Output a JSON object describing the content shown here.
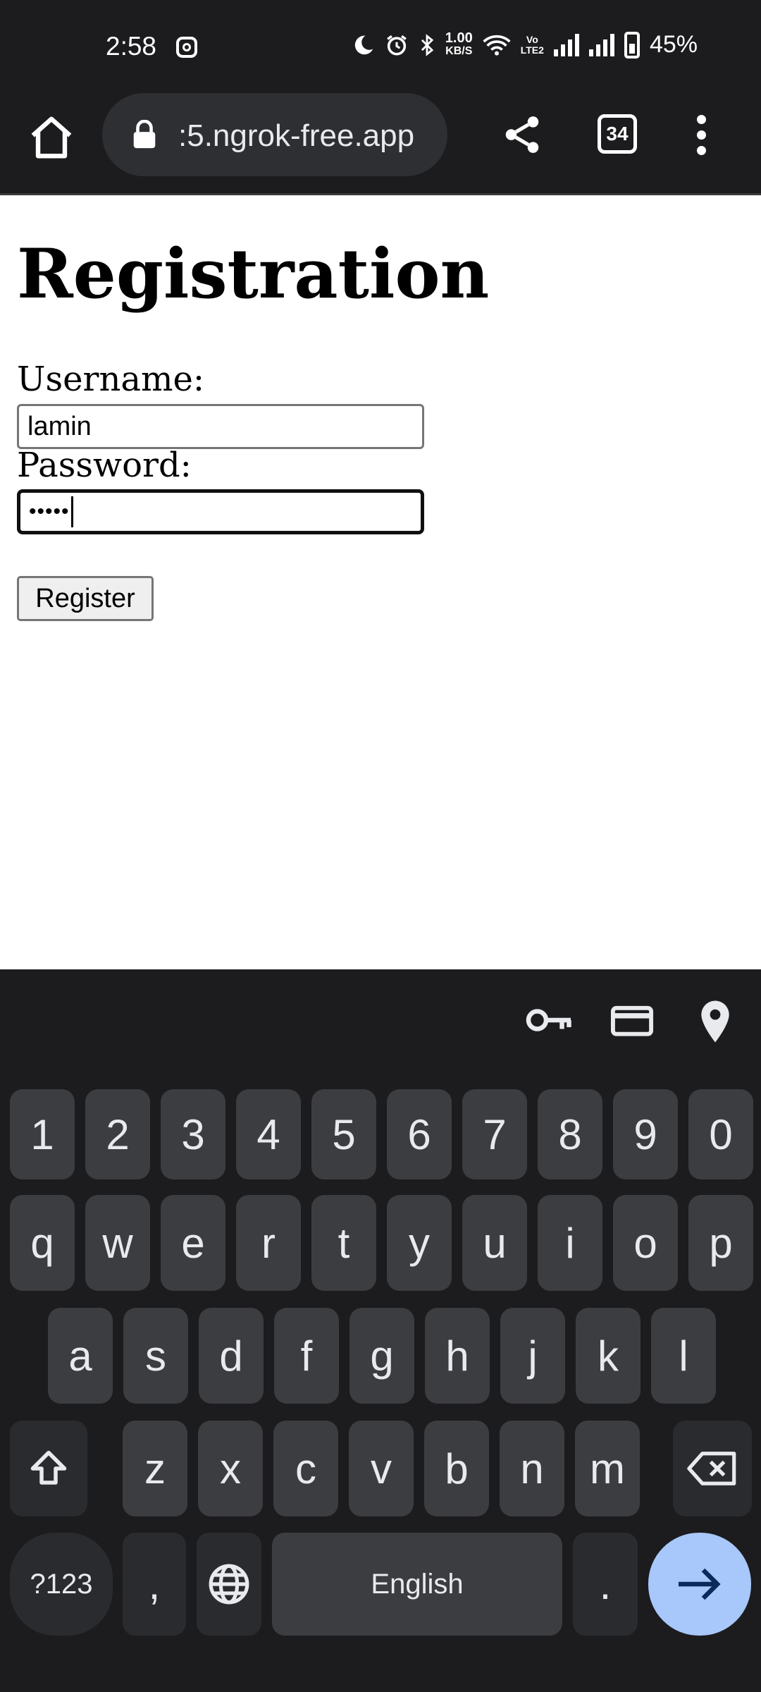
{
  "status_bar": {
    "time": "2:58",
    "speed_top": "1.00",
    "speed_bottom": "KB/S",
    "volte_top": "Vo",
    "volte_bottom": "LTE2",
    "battery": "45%"
  },
  "browser": {
    "url": ":5.ngrok-free.app",
    "tab_count": "34"
  },
  "page": {
    "title": "Registration",
    "username_label": "Username:",
    "username_value": "lamin",
    "password_label": "Password:",
    "password_value": "•••••",
    "register_label": "Register"
  },
  "keyboard": {
    "tools": [
      "key-icon",
      "card-icon",
      "location-icon"
    ],
    "row_numbers": [
      "1",
      "2",
      "3",
      "4",
      "5",
      "6",
      "7",
      "8",
      "9",
      "0"
    ],
    "row_top": [
      "q",
      "w",
      "e",
      "r",
      "t",
      "y",
      "u",
      "i",
      "o",
      "p"
    ],
    "row_mid": [
      "a",
      "s",
      "d",
      "f",
      "g",
      "h",
      "j",
      "k",
      "l"
    ],
    "row_bottom": [
      "z",
      "x",
      "c",
      "v",
      "b",
      "n",
      "m"
    ],
    "symbols_label": "?123",
    "comma": ",",
    "space_label": "English",
    "period": ".",
    "colors": {
      "enter": "#a8c7fa",
      "key": "#3c3d41",
      "background": "#1c1c1e"
    }
  }
}
